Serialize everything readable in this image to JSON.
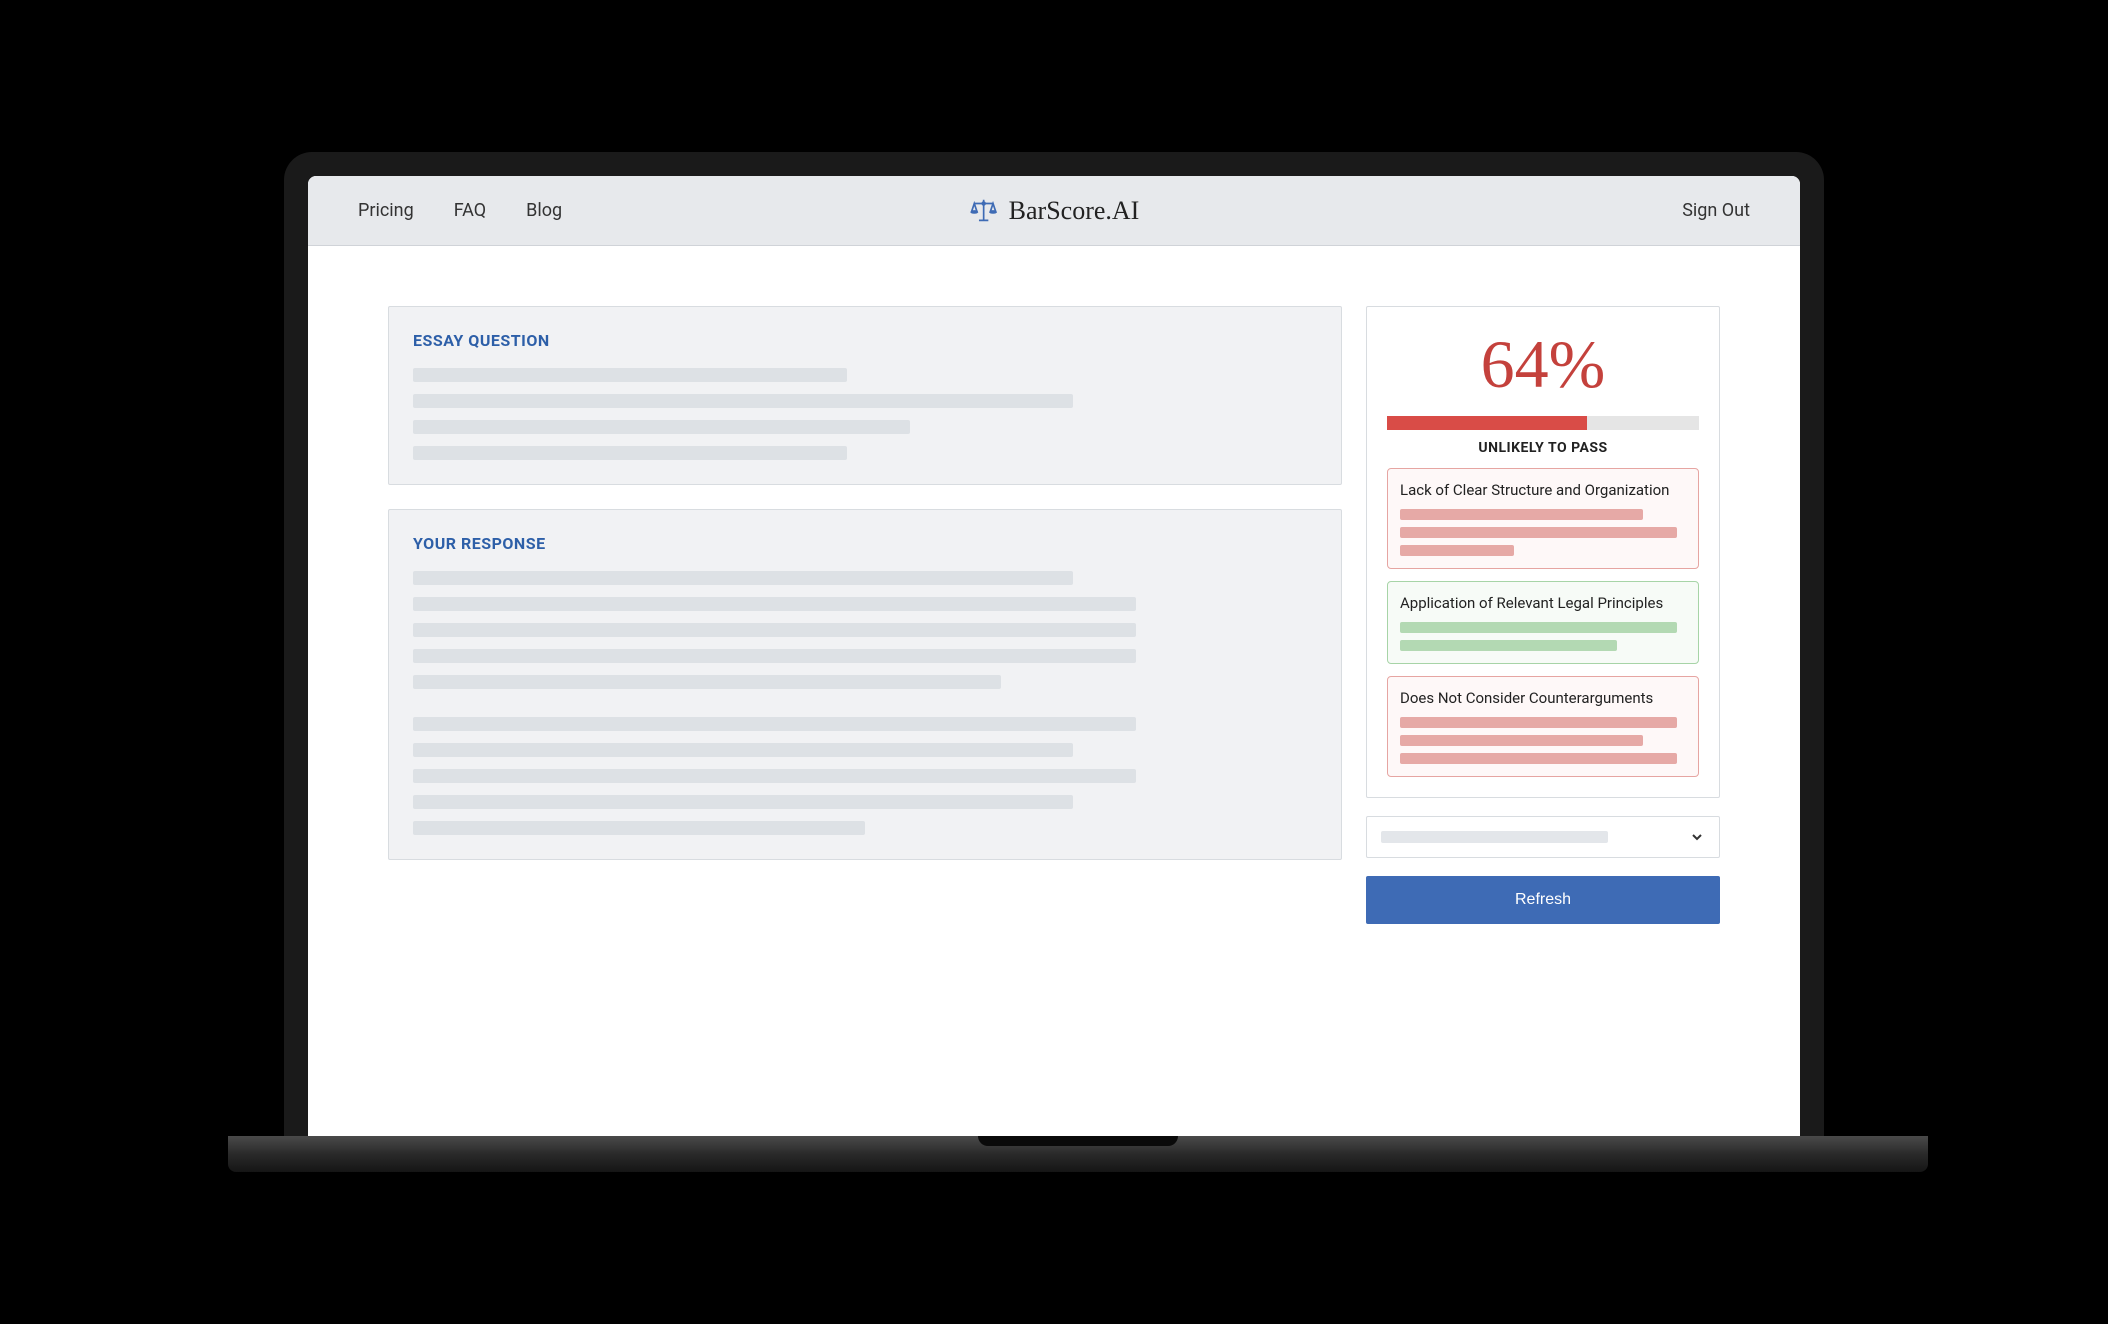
{
  "nav": {
    "links": [
      "Pricing",
      "FAQ",
      "Blog"
    ],
    "logo_text": "BarScore.AI",
    "sign_out": "Sign Out"
  },
  "essay": {
    "title": "ESSAY QUESTION"
  },
  "response": {
    "title": "YOUR RESPONSE"
  },
  "score": {
    "percent": "64%",
    "fill_pct": 64,
    "label": "UNLIKELY TO PASS"
  },
  "feedback": [
    {
      "type": "negative",
      "title": "Lack of Clear Structure and Organization",
      "line_widths": [
        85,
        97,
        40
      ]
    },
    {
      "type": "positive",
      "title": "Application of Relevant Legal Principles",
      "line_widths": [
        97,
        76
      ]
    },
    {
      "type": "negative",
      "title": "Does Not Consider Counterarguments",
      "line_widths": [
        97,
        85,
        97
      ]
    }
  ],
  "refresh_label": "Refresh"
}
